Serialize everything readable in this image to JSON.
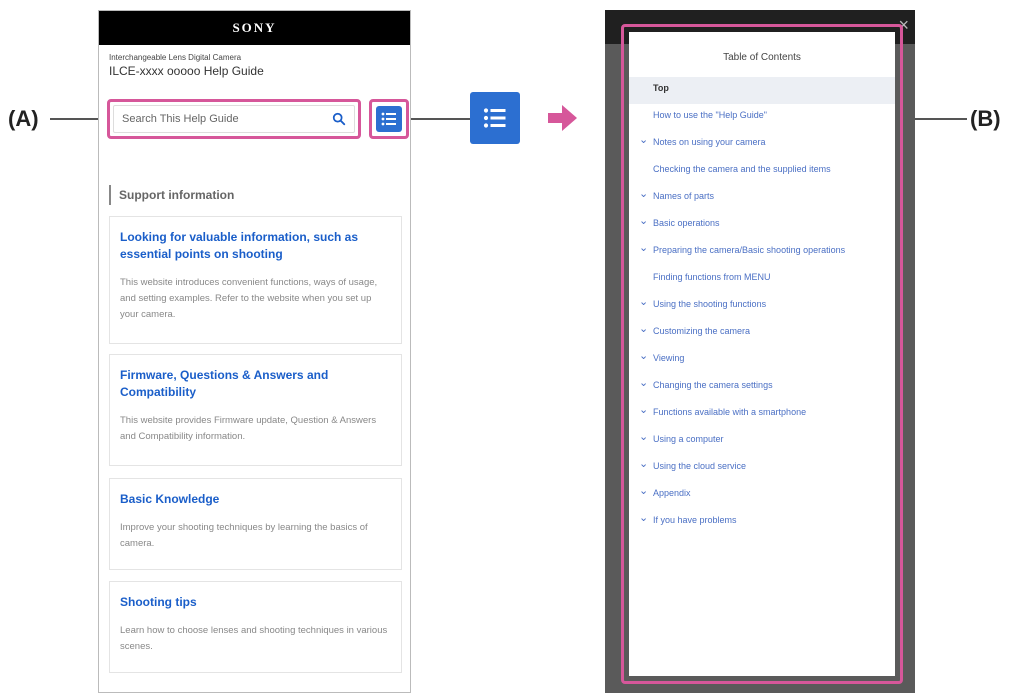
{
  "callouts": {
    "a": "(A)",
    "b": "(B)"
  },
  "left_page": {
    "brand": "SONY",
    "subtitle": "Interchangeable Lens Digital Camera",
    "title": "ILCE-xxxx ooooo Help Guide",
    "search_placeholder": "Search This Help Guide",
    "support_heading": "Support information",
    "cards": [
      {
        "title": "Looking for valuable information, such as essential points on shooting",
        "desc": "This website introduces convenient functions, ways of usage, and setting examples. Refer to the website when you set up your camera."
      },
      {
        "title": "Firmware, Questions & Answers and Compatibility",
        "desc": "This website provides Firmware update, Question & Answers and Compatibility information."
      },
      {
        "title": "Basic Knowledge",
        "desc": "Improve your shooting techniques by learning the basics of camera."
      },
      {
        "title": "Shooting tips",
        "desc": "Learn how to choose lenses and shooting techniques in various scenes."
      }
    ]
  },
  "right_page": {
    "toc_title": "Table of Contents",
    "items": [
      {
        "label": "Top",
        "chevron": false,
        "top": true
      },
      {
        "label": "How to use the \"Help Guide\"",
        "chevron": false
      },
      {
        "label": "Notes on using your camera",
        "chevron": true
      },
      {
        "label": "Checking the camera and the supplied items",
        "chevron": false
      },
      {
        "label": "Names of parts",
        "chevron": true
      },
      {
        "label": "Basic operations",
        "chevron": true
      },
      {
        "label": "Preparing the camera/Basic shooting operations",
        "chevron": true
      },
      {
        "label": "Finding functions from MENU",
        "chevron": false
      },
      {
        "label": "Using the shooting functions",
        "chevron": true
      },
      {
        "label": "Customizing the camera",
        "chevron": true
      },
      {
        "label": "Viewing",
        "chevron": true
      },
      {
        "label": "Changing the camera settings",
        "chevron": true
      },
      {
        "label": "Functions available with a smartphone",
        "chevron": true
      },
      {
        "label": "Using a computer",
        "chevron": true
      },
      {
        "label": "Using the cloud service",
        "chevron": true
      },
      {
        "label": "Appendix",
        "chevron": true
      },
      {
        "label": "If you have problems",
        "chevron": true
      }
    ]
  },
  "colors": {
    "accent_blue": "#2c6fd1",
    "callout_pink": "#d6579a",
    "link_blue": "#4a6fc4"
  }
}
